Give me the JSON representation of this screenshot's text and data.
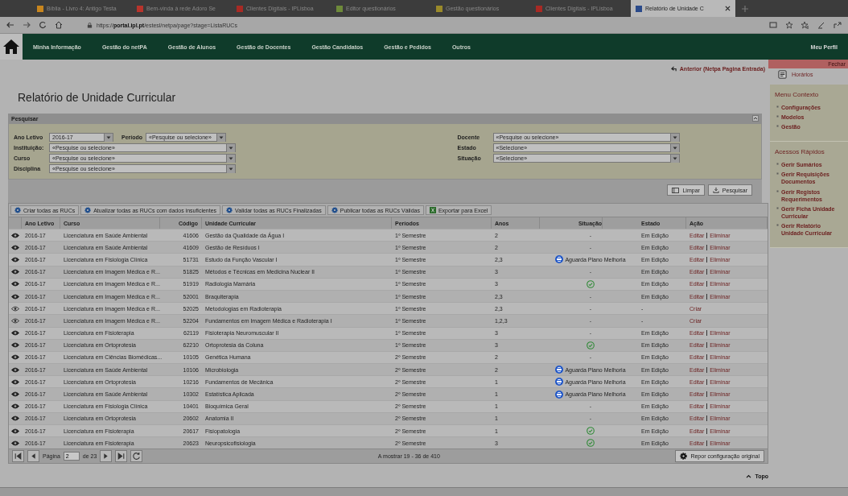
{
  "browser": {
    "tabs": [
      {
        "title": "Bíblia - Livro 4: Antigo Testa",
        "color": "#c8861e",
        "selected": false
      },
      {
        "title": "Bem-vinda à rede Adoro Se",
        "color": "#b8342c",
        "selected": false
      },
      {
        "title": "Clientes Digitais - IPLisboa",
        "color": "#a82a24",
        "selected": false
      },
      {
        "title": "Editor questionários",
        "color": "#6e8a3a",
        "selected": false
      },
      {
        "title": "Gestão questionários",
        "color": "#9a8a2a",
        "selected": false
      },
      {
        "title": "Clientes Digitais - IPLisboa",
        "color": "#a82a24",
        "selected": false
      },
      {
        "title": "Relatório de Unidade C",
        "color": "#2a4a8a",
        "selected": true
      }
    ],
    "url_prefix": "https://",
    "url_host": "portal.ipl.pt",
    "url_path": "/estesl/netpa/page?stage=ListaRUCs"
  },
  "nav": {
    "items": [
      "Minha Informação",
      "Gestão do netPA",
      "Gestão de Alunos",
      "Gestão de Docentes",
      "Gestão Candidatos",
      "Gestão e Pedidos",
      "Outros"
    ],
    "profile": "Meu Perfil"
  },
  "back_link": "Anterior (Netpa Pagina Entrada)",
  "page_title": "Relatório de Unidade Curricular",
  "search": {
    "title": "Pesquisar",
    "left_rows": [
      [
        {
          "label": "Ano Letivo",
          "value": "2016-17"
        },
        {
          "label": "Período",
          "value": "«Pesquise ou selecione»"
        }
      ],
      [
        {
          "label": "Instituição:",
          "value": "«Pesquise ou selecione»"
        }
      ],
      [
        {
          "label": "Curso",
          "value": "«Pesquise ou selecione»"
        }
      ],
      [
        {
          "label": "Disciplina",
          "value": "«Pesquise ou selecione»"
        }
      ]
    ],
    "right_rows": [
      {
        "label": "Docente",
        "value": "«Pesquise ou selecione»"
      },
      {
        "label": "Estado",
        "value": "«Selecione»"
      },
      {
        "label": "Situação",
        "value": "«Selecione»"
      }
    ],
    "buttons": [
      "Limpar",
      "Pesquisar"
    ]
  },
  "toolbar": [
    {
      "label": "Criar todas as RUCs",
      "kind": "gear"
    },
    {
      "label": "Atualizar todas as RUCs com dados insuficientes",
      "kind": "gear"
    },
    {
      "label": "Validar todas as RUCs Finalizadas",
      "kind": "gear"
    },
    {
      "label": "Publicar todas as RUCs Válidas",
      "kind": "gear"
    },
    {
      "label": "Exportar para Excel",
      "kind": "excel"
    }
  ],
  "table": {
    "columns": [
      "Ano Letivo",
      "Curso",
      "Código",
      "Unidade Curricular",
      "Períodos",
      "Anos",
      "Situação",
      "Estado",
      "Ação"
    ],
    "rows": [
      {
        "view_enabled": true,
        "ano": "2016-17",
        "curso": "Licenciatura em Saúde Ambiental",
        "codigo": "41606",
        "uc": "Gestão da Qualidade da Água I",
        "periodo": "1º Semestre",
        "anos": "2",
        "situacao": {
          "kind": "none",
          "text": "-"
        },
        "estado": "Em Edição",
        "acoes": [
          "Editar",
          "Eliminar"
        ]
      },
      {
        "view_enabled": true,
        "ano": "2016-17",
        "curso": "Licenciatura em Saúde Ambiental",
        "codigo": "41609",
        "uc": "Gestão de Resíduos I",
        "periodo": "1º Semestre",
        "anos": "2",
        "situacao": {
          "kind": "none",
          "text": "-"
        },
        "estado": "Em Edição",
        "acoes": [
          "Editar",
          "Eliminar"
        ]
      },
      {
        "view_enabled": true,
        "ano": "2016-17",
        "curso": "Licenciatura em Fisiologia Clínica",
        "codigo": "51731",
        "uc": "Estudo da Função Vascular I",
        "periodo": "1º Semestre",
        "anos": "2,3",
        "situacao": {
          "kind": "pending",
          "text": "Aguarda Plano Melhoria"
        },
        "estado": "Em Edição",
        "acoes": [
          "Editar",
          "Eliminar"
        ]
      },
      {
        "view_enabled": true,
        "ano": "2016-17",
        "curso": "Licenciatura em Imagem Médica e R...",
        "codigo": "51825",
        "uc": "Métodos e Técnicas em Medicina Nuclear II",
        "periodo": "1º Semestre",
        "anos": "3",
        "situacao": {
          "kind": "none",
          "text": "-"
        },
        "estado": "Em Edição",
        "acoes": [
          "Editar",
          "Eliminar"
        ]
      },
      {
        "view_enabled": true,
        "ano": "2016-17",
        "curso": "Licenciatura em Imagem Médica e R...",
        "codigo": "51919",
        "uc": "Radiologia Mamária",
        "periodo": "1º Semestre",
        "anos": "3",
        "situacao": {
          "kind": "ok"
        },
        "estado": "Em Edição",
        "acoes": [
          "Editar",
          "Eliminar"
        ]
      },
      {
        "view_enabled": true,
        "ano": "2016-17",
        "curso": "Licenciatura em Imagem Médica e R...",
        "codigo": "52001",
        "uc": "Braquiterapia",
        "periodo": "1º Semestre",
        "anos": "2,3",
        "situacao": {
          "kind": "none",
          "text": "-"
        },
        "estado": "Em Edição",
        "acoes": [
          "Editar",
          "Eliminar"
        ]
      },
      {
        "view_enabled": false,
        "ano": "2016-17",
        "curso": "Licenciatura em Imagem Médica e R...",
        "codigo": "52025",
        "uc": "Metodologias em Radioterapia",
        "periodo": "1º Semestre",
        "anos": "2,3",
        "situacao": {
          "kind": "none",
          "text": "-"
        },
        "estado": "-",
        "acoes": [
          "Criar"
        ]
      },
      {
        "view_enabled": false,
        "ano": "2016-17",
        "curso": "Licenciatura em Imagem Médica e R...",
        "codigo": "52204",
        "uc": "Fundamentos em Imagem Médica e Radioterapia I",
        "periodo": "1º Semestre",
        "anos": "1,2,3",
        "situacao": {
          "kind": "none",
          "text": "-"
        },
        "estado": "-",
        "acoes": [
          "Criar"
        ]
      },
      {
        "view_enabled": true,
        "ano": "2016-17",
        "curso": "Licenciatura em Fisioterapia",
        "codigo": "62119",
        "uc": "Fisioterapia Neuromuscular II",
        "periodo": "1º Semestre",
        "anos": "3",
        "situacao": {
          "kind": "none",
          "text": "-"
        },
        "estado": "Em Edição",
        "acoes": [
          "Editar",
          "Eliminar"
        ]
      },
      {
        "view_enabled": true,
        "ano": "2016-17",
        "curso": "Licenciatura em Ortoprotesia",
        "codigo": "62210",
        "uc": "Ortoprotesia da Coluna",
        "periodo": "1º Semestre",
        "anos": "3",
        "situacao": {
          "kind": "ok"
        },
        "estado": "Em Edição",
        "acoes": [
          "Editar",
          "Eliminar"
        ]
      },
      {
        "view_enabled": true,
        "ano": "2016-17",
        "curso": "Licenciatura em Ciências Biomédicas...",
        "codigo": "10105",
        "uc": "Genética Humana",
        "periodo": "2º Semestre",
        "anos": "2",
        "situacao": {
          "kind": "none",
          "text": "-"
        },
        "estado": "Em Edição",
        "acoes": [
          "Editar",
          "Eliminar"
        ]
      },
      {
        "view_enabled": true,
        "ano": "2016-17",
        "curso": "Licenciatura em Saúde Ambiental",
        "codigo": "10106",
        "uc": "Microbiologia",
        "periodo": "2º Semestre",
        "anos": "2",
        "situacao": {
          "kind": "pending",
          "text": "Aguarda Plano Melhoria"
        },
        "estado": "Em Edição",
        "acoes": [
          "Editar",
          "Eliminar"
        ]
      },
      {
        "view_enabled": true,
        "ano": "2016-17",
        "curso": "Licenciatura em Ortoprotesia",
        "codigo": "10216",
        "uc": "Fundamentos de Mecânica",
        "periodo": "2º Semestre",
        "anos": "1",
        "situacao": {
          "kind": "pending",
          "text": "Aguarda Plano Melhoria"
        },
        "estado": "Em Edição",
        "acoes": [
          "Editar",
          "Eliminar"
        ]
      },
      {
        "view_enabled": true,
        "ano": "2016-17",
        "curso": "Licenciatura em Saúde Ambiental",
        "codigo": "10302",
        "uc": "Estatística Aplicada",
        "periodo": "2º Semestre",
        "anos": "1",
        "situacao": {
          "kind": "pending",
          "text": "Aguarda Plano Melhoria"
        },
        "estado": "Em Edição",
        "acoes": [
          "Editar",
          "Eliminar"
        ]
      },
      {
        "view_enabled": true,
        "ano": "2016-17",
        "curso": "Licenciatura em Fisiologia Clínica",
        "codigo": "10401",
        "uc": "Bioquímica Geral",
        "periodo": "2º Semestre",
        "anos": "1",
        "situacao": {
          "kind": "none",
          "text": "-"
        },
        "estado": "Em Edição",
        "acoes": [
          "Editar",
          "Eliminar"
        ]
      },
      {
        "view_enabled": true,
        "ano": "2016-17",
        "curso": "Licenciatura em Ortoprotesia",
        "codigo": "20602",
        "uc": "Anatomia II",
        "periodo": "2º Semestre",
        "anos": "1",
        "situacao": {
          "kind": "none",
          "text": "-"
        },
        "estado": "Em Edição",
        "acoes": [
          "Editar",
          "Eliminar"
        ]
      },
      {
        "view_enabled": true,
        "ano": "2016-17",
        "curso": "Licenciatura em Fisioterapia",
        "codigo": "20617",
        "uc": "Fisiopatologia",
        "periodo": "2º Semestre",
        "anos": "1",
        "situacao": {
          "kind": "ok"
        },
        "estado": "Em Edição",
        "acoes": [
          "Editar",
          "Eliminar"
        ]
      },
      {
        "view_enabled": true,
        "ano": "2016-17",
        "curso": "Licenciatura em Fisioterapia",
        "codigo": "20623",
        "uc": "Neuropsicofisiologia",
        "periodo": "2º Semestre",
        "anos": "3",
        "situacao": {
          "kind": "ok"
        },
        "estado": "Em Edição",
        "acoes": [
          "Editar",
          "Eliminar"
        ]
      }
    ]
  },
  "pager": {
    "page_label": "Página",
    "page": "2",
    "of": "de 23",
    "summary": "A mostrar 19 - 36 de 410",
    "reset": "Repor configuração original"
  },
  "top_link": "Topo",
  "sidebar": {
    "close": "Fechar",
    "schedule": "Horários",
    "sections": [
      {
        "title": "Menu Contexto",
        "items": [
          "Configurações",
          "Modelos",
          "Gestão"
        ]
      },
      {
        "title": "Acessos Rápidos",
        "items": [
          "Gerir Sumários",
          "Gerir Requisições Documentos",
          "Gerir Registos Requerimentos",
          "Gerir Ficha Unidade Curricular",
          "Gerir Relatório Unidade Curricular"
        ]
      }
    ]
  }
}
